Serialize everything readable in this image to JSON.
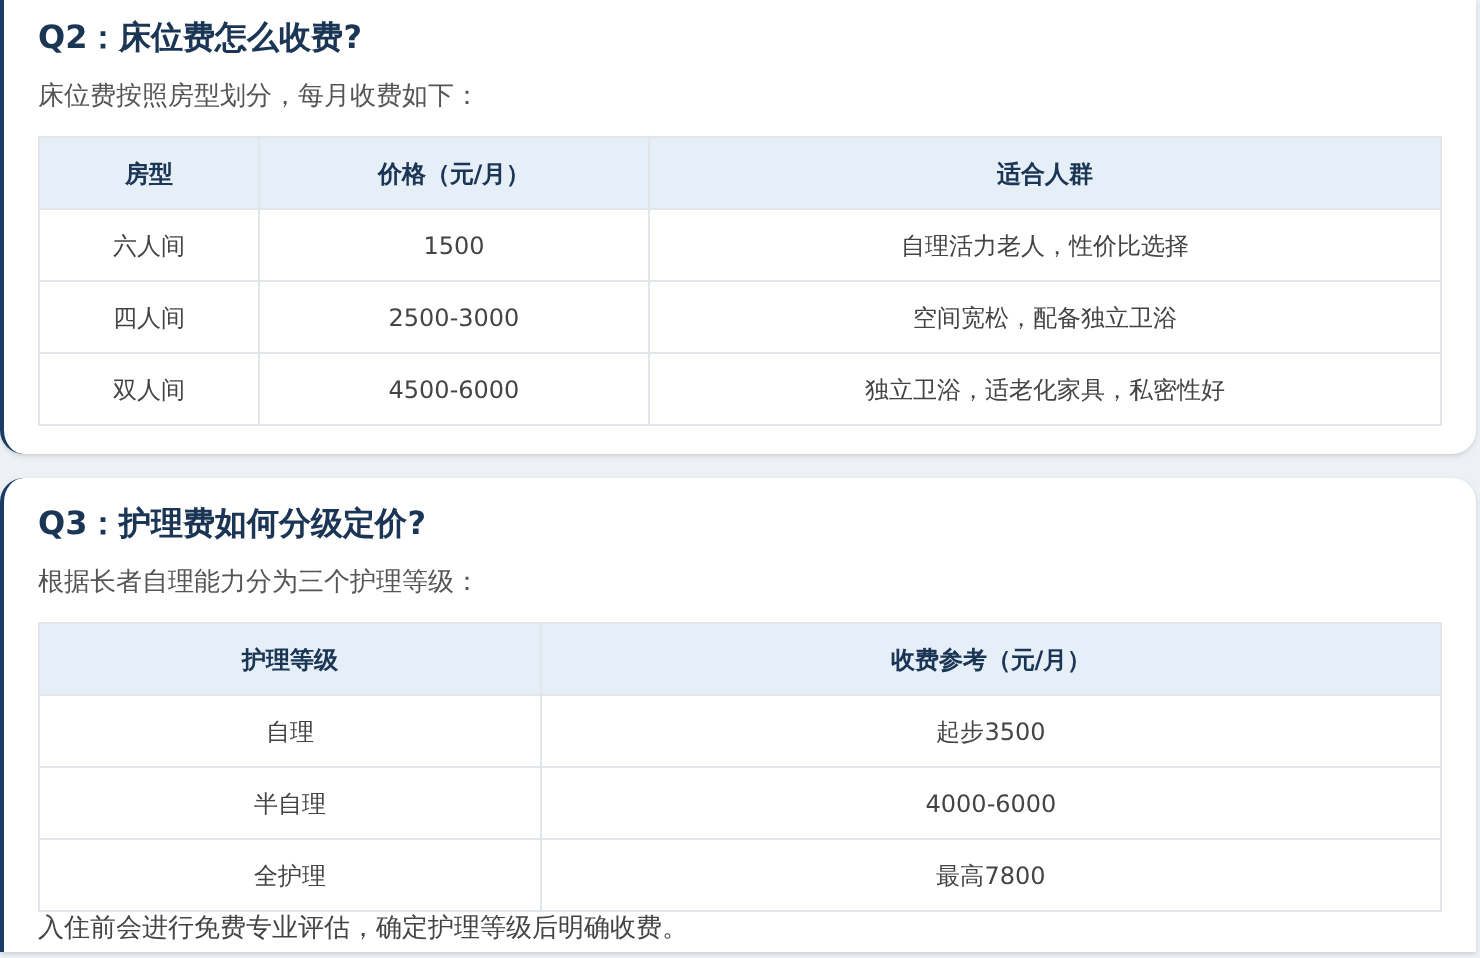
{
  "sections": [
    {
      "title": "Q2：床位费怎么收费?",
      "intro": "床位费按照房型划分，每月收费如下：",
      "table": {
        "columns": [
          "房型",
          "价格（元/月）",
          "适合人群"
        ],
        "rows": [
          [
            "六人间",
            "1500",
            "自理活力老人，性价比选择"
          ],
          [
            "四人间",
            "2500-3000",
            "空间宽松，配备独立卫浴"
          ],
          [
            "双人间",
            "4500-6000",
            "独立卫浴，适老化家具，私密性好"
          ]
        ]
      }
    },
    {
      "title": "Q3：护理费如何分级定价?",
      "intro": "根据长者自理能力分为三个护理等级：",
      "table": {
        "columns": [
          "护理等级",
          "收费参考（元/月）"
        ],
        "rows": [
          [
            "自理",
            "起步3500"
          ],
          [
            "半自理",
            "4000-6000"
          ],
          [
            "全护理",
            "最高7800"
          ]
        ]
      },
      "note": "入住前会进行免费专业评估，确定护理等级后明确收费。"
    }
  ]
}
